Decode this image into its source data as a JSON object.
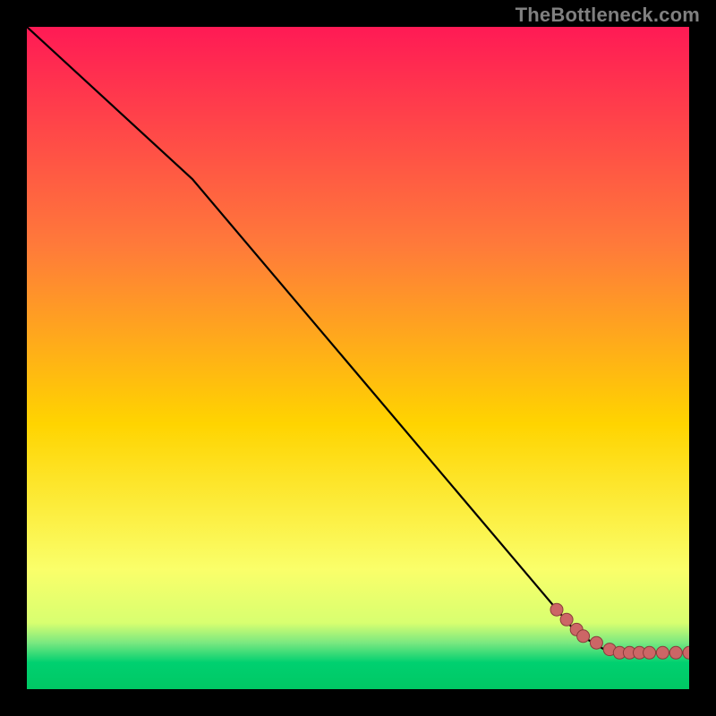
{
  "watermark": "TheBottleneck.com",
  "colors": {
    "page_bg": "#000000",
    "watermark": "#808080",
    "curve_stroke": "#000000",
    "marker_fill": "#cc6666",
    "marker_stroke": "#8a3c3c",
    "gradient_top": "#ff1a55",
    "gradient_upper_mid": "#ff6a3a",
    "gradient_mid": "#ffd400",
    "gradient_lower_mid": "#f6ff5a",
    "gradient_green_band": "#00d070",
    "gradient_bottom": "#00c864"
  },
  "chart_data": {
    "type": "line",
    "title": "",
    "xlabel": "",
    "ylabel": "",
    "xlim": [
      0,
      100
    ],
    "ylim": [
      0,
      100
    ],
    "grid": false,
    "legend_position": "none",
    "series": [
      {
        "name": "curve",
        "x": [
          0,
          25,
          83,
          88,
          100
        ],
        "y": [
          100,
          77,
          8.5,
          5.5,
          5.5
        ]
      }
    ],
    "markers": {
      "name": "highlighted-points",
      "x": [
        80,
        81.5,
        83,
        84,
        86,
        88,
        89.5,
        91,
        92.5,
        94,
        96,
        98,
        100
      ],
      "y": [
        12,
        10.5,
        9,
        8,
        7,
        6,
        5.5,
        5.5,
        5.5,
        5.5,
        5.5,
        5.5,
        5.5
      ]
    },
    "background": {
      "type": "vertical-gradient",
      "stops": [
        {
          "offset": 0.0,
          "color": "#ff1a55"
        },
        {
          "offset": 0.33,
          "color": "#ff7a3a"
        },
        {
          "offset": 0.6,
          "color": "#ffd400"
        },
        {
          "offset": 0.82,
          "color": "#faff6a"
        },
        {
          "offset": 0.9,
          "color": "#d8ff70"
        },
        {
          "offset": 0.93,
          "color": "#7ae880"
        },
        {
          "offset": 0.96,
          "color": "#00d070"
        },
        {
          "offset": 1.0,
          "color": "#00c864"
        }
      ]
    }
  }
}
